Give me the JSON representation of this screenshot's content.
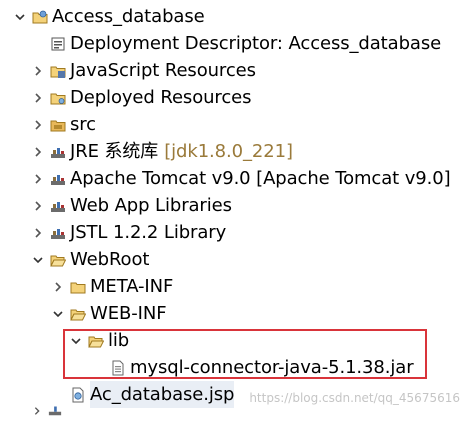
{
  "tree": {
    "project": {
      "label": "Access_database",
      "expanded": true,
      "children": [
        {
          "label": "Deployment Descriptor: Access_database",
          "icon": "deployment-descriptor-icon"
        },
        {
          "label": "JavaScript Resources",
          "icon": "javascript-resources-icon"
        },
        {
          "label": "Deployed Resources",
          "icon": "folder-icon"
        },
        {
          "label": "src",
          "icon": "source-folder-icon"
        },
        {
          "label": "JRE 系统库",
          "suffix": "[jdk1.8.0_221]",
          "icon": "library-icon"
        },
        {
          "label": "Apache Tomcat v9.0 [Apache Tomcat v9.0]",
          "icon": "library-icon"
        },
        {
          "label": "Web App Libraries",
          "icon": "library-icon"
        },
        {
          "label": "JSTL 1.2.2 Library",
          "icon": "library-icon"
        },
        {
          "label": "WebRoot",
          "icon": "folder-icon",
          "expanded": true,
          "children": [
            {
              "label": "META-INF",
              "icon": "folder-icon"
            },
            {
              "label": "WEB-INF",
              "icon": "folder-icon",
              "expanded": true,
              "children": [
                {
                  "label": "lib",
                  "icon": "folder-icon",
                  "expanded": true,
                  "children": [
                    {
                      "label": "mysql-connector-java-5.1.38.jar",
                      "icon": "jar-icon"
                    }
                  ]
                }
              ]
            },
            {
              "label": "Ac_database.jsp",
              "icon": "jsp-file-icon"
            }
          ]
        }
      ]
    }
  },
  "watermark": "https://blog.csdn.net/qq_45675616",
  "colors": {
    "highlight": "#d9343a",
    "suffix": "#9a7a3a"
  }
}
